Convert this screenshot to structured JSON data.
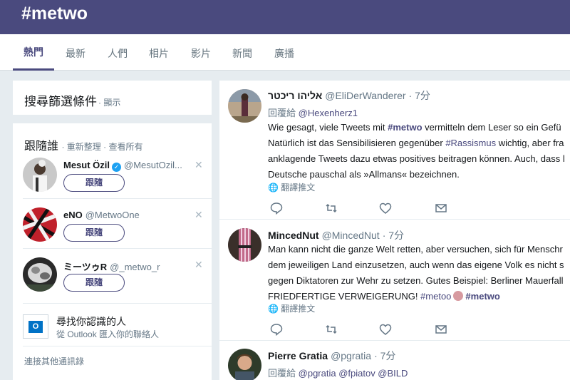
{
  "header": {
    "hashtag": "#metwo"
  },
  "tabs": [
    "熱門",
    "最新",
    "人們",
    "相片",
    "影片",
    "新聞",
    "廣播"
  ],
  "search_filters": {
    "title": "搜尋篩選條件",
    "show": "· 顯示"
  },
  "who_to_follow": {
    "title": "跟隨誰",
    "links": "· 重新整理 · 查看所有",
    "follow_label": "跟隨",
    "accounts": [
      {
        "name": "Mesut Özil",
        "handle": "@MesutOzil...",
        "verified": true
      },
      {
        "name": "eNO",
        "handle": "@MetwoOne",
        "verified": false
      },
      {
        "name": "ミーツゥR",
        "handle": "@_metwo_r",
        "verified": false
      }
    ]
  },
  "find_people": {
    "title": "尋找你認識的人",
    "subtitle": "從 Outlook 匯入你的聯絡人",
    "icon_letter": "O"
  },
  "connect_other": "連接其他通訊錄",
  "translate_label": "翻譯推文",
  "tweets": [
    {
      "name": "אליהו ריכטר",
      "handle": "@EliDerWanderer",
      "time": "· 7分",
      "reply_prefix": "回覆給",
      "reply_to": "@Hexenherz1",
      "lines": [
        [
          "Wie gesagt, viele Tweets mit ",
          "#metwo",
          " vermitteln dem Leser so ein Gefü"
        ],
        [
          "Natürlich ist das Sensibilisieren gegenüber ",
          "#Rassismus",
          " wichtig, aber fra"
        ],
        [
          "anklagende Tweets dazu etwas positives beitragen können. Auch, dass l"
        ],
        [
          "Deutsche pauschal als »Allmans« bezeichnen."
        ]
      ]
    },
    {
      "name": "MincedNut",
      "handle": "@MincedNut",
      "time": "· 7分",
      "lines": [
        [
          "Man kann nicht die ganze Welt retten, aber versuchen, sich für Menschr"
        ],
        [
          "dem jeweiligen Land einzusetzen, auch wenn das eigene Volk es nicht s"
        ],
        [
          "gegen Diktatoren zur Wehr zu setzen. Gutes Beispiel: Berliner Mauerfall"
        ],
        [
          "FRIEDFERTIGE VERWEIGERUNG! ",
          "#metoo",
          "",
          "#metwo"
        ]
      ]
    },
    {
      "name": "Pierre Gratia",
      "handle": "@pgratia",
      "time": "· 7分",
      "reply_prefix": "回覆給",
      "reply_to": "@pgratia @fpiatov @BILD"
    }
  ]
}
